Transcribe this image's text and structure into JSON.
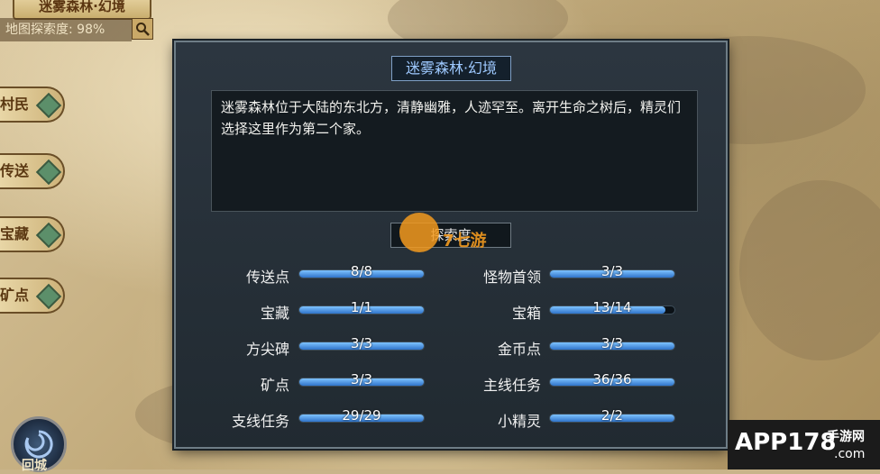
{
  "map": {
    "title": "迷雾森林·幻境",
    "explore_rate": "地图探索度: 98%"
  },
  "side_tabs": [
    {
      "label": "村民"
    },
    {
      "label": "传送"
    },
    {
      "label": "宝藏"
    },
    {
      "label": "矿点"
    }
  ],
  "bottom_button": {
    "label": "回城"
  },
  "dialog": {
    "title": "迷雾森林·幻境",
    "description": "迷雾森林位于大陆的东北方，清静幽雅，人迹罕至。离开生命之树后，精灵们选择这里作为第二个家。",
    "section_title": "探索度",
    "stats": [
      {
        "label": "传送点",
        "value": "8/8",
        "fill": 1.0
      },
      {
        "label": "怪物首领",
        "value": "3/3",
        "fill": 1.0
      },
      {
        "label": "宝藏",
        "value": "1/1",
        "fill": 1.0
      },
      {
        "label": "宝箱",
        "value": "13/14",
        "fill": 0.93
      },
      {
        "label": "方尖碑",
        "value": "3/3",
        "fill": 1.0
      },
      {
        "label": "金币点",
        "value": "3/3",
        "fill": 1.0
      },
      {
        "label": "矿点",
        "value": "3/3",
        "fill": 1.0
      },
      {
        "label": "主线任务",
        "value": "36/36",
        "fill": 1.0
      },
      {
        "label": "支线任务",
        "value": "29/29",
        "fill": 1.0
      },
      {
        "label": "小精灵",
        "value": "2/2",
        "fill": 1.0
      }
    ]
  },
  "watermark": {
    "text": "7七游"
  },
  "corner_logo": {
    "app": "APP178",
    "tag": "手游网",
    "com": ".com"
  },
  "colors": {
    "bar_fill": "#4a9ae8",
    "title_text": "#9ec9ff"
  },
  "icons": {
    "search": "search-icon",
    "gem": "diamond-gem-icon"
  }
}
